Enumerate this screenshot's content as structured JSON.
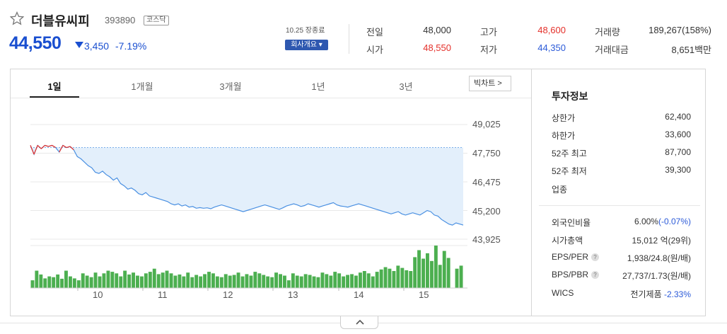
{
  "stock": {
    "name": "더블유씨피",
    "code": "393890",
    "market": "코스닥",
    "price": "44,550",
    "change": "3,450",
    "change_rate": "-7.19%",
    "close_time": "10.25 장종료",
    "company_button": "회사개요 ▾"
  },
  "quotes": {
    "prev_label": "전일",
    "prev": "48,000",
    "high_label": "고가",
    "high": "48,600",
    "volume_label": "거래량",
    "volume": "189,267(158%)",
    "open_label": "시가",
    "open": "48,550",
    "low_label": "저가",
    "low": "44,350",
    "amount_label": "거래대금",
    "amount": "8,651",
    "amount_unit": "백만"
  },
  "tabs": [
    "1일",
    "1개월",
    "3개월",
    "1년",
    "3년"
  ],
  "big_chart_label": "빅차트 >",
  "chart_data": {
    "type": "line",
    "ylim": [
      43925,
      49025
    ],
    "yticks": [
      "49,025",
      "47,750",
      "46,475",
      "45,200",
      "43,925"
    ],
    "xticks": [
      "10",
      "11",
      "12",
      "13",
      "14",
      "15"
    ],
    "prev_close": 48000,
    "price": [
      48100,
      47700,
      48100,
      47950,
      48100,
      48050,
      48100,
      48000,
      47800,
      48100,
      48000,
      48050,
      47900,
      47600,
      47500,
      47350,
      47200,
      47100,
      46900,
      46850,
      46950,
      46800,
      46700,
      46550,
      46650,
      46400,
      46300,
      46150,
      46200,
      46100,
      45950,
      45900,
      46000,
      45850,
      45800,
      45750,
      45700,
      45650,
      45600,
      45500,
      45450,
      45500,
      45400,
      45450,
      45350,
      45380,
      45300,
      45330,
      45300,
      45320,
      45280,
      45350,
      45400,
      45450,
      45400,
      45350,
      45300,
      45250,
      45200,
      45150,
      45200,
      45250,
      45300,
      45350,
      45400,
      45450,
      45400,
      45350,
      45300,
      45250,
      45320,
      45400,
      45450,
      45500,
      45450,
      45380,
      45420,
      45500,
      45450,
      45400,
      45350,
      45400,
      45450,
      45500,
      45550,
      45450,
      45400,
      45380,
      45350,
      45400,
      45450,
      45500,
      45450,
      45400,
      45350,
      45300,
      45250,
      45200,
      45150,
      45100,
      45050,
      45100,
      45150,
      45050,
      45000,
      45050,
      45100,
      45050,
      45000,
      45100,
      45200,
      45150,
      45000,
      44950,
      44800,
      44700,
      44600,
      44550,
      44650,
      44600,
      44550
    ],
    "volume": [
      20,
      45,
      35,
      25,
      30,
      28,
      35,
      24,
      45,
      30,
      25,
      20,
      38,
      32,
      28,
      40,
      30,
      38,
      45,
      42,
      38,
      30,
      45,
      35,
      40,
      32,
      30,
      38,
      42,
      50,
      36,
      40,
      45,
      38,
      32,
      35,
      30,
      40,
      28,
      34,
      30,
      36,
      42,
      38,
      30,
      28,
      36,
      32,
      34,
      40,
      30,
      36,
      32,
      42,
      38,
      34,
      30,
      28,
      40,
      36,
      32,
      20,
      38,
      32,
      30,
      36,
      34,
      30,
      28,
      40,
      36,
      32,
      42,
      38,
      30,
      34,
      36,
      32,
      40,
      44,
      38,
      30,
      42,
      48,
      54,
      50,
      44,
      58,
      52,
      46,
      44,
      80,
      98,
      76,
      90,
      70,
      110,
      60,
      96,
      78,
      0,
      50,
      58
    ]
  },
  "side": {
    "title": "투자정보",
    "upper_label": "상한가",
    "upper": "62,400",
    "lower_label": "하한가",
    "lower": "33,600",
    "w52_high_label": "52주 최고",
    "w52_high": "87,700",
    "w52_low_label": "52주 최저",
    "w52_low": "39,300",
    "sector_label": "업종",
    "foreign_label": "외국인비율",
    "foreign": "6.00%",
    "foreign_chg": "(-0.07%)",
    "mcap_label": "시가총액",
    "mcap": "15,012",
    "mcap_unit": "억(29위)",
    "eps_label": "EPS/PER",
    "eps": "1,938/24.8",
    "eps_unit": "(원/배)",
    "bps_label": "BPS/PBR",
    "bps": "27,737/1.73",
    "bps_unit": "(원/배)",
    "wics_label": "WICS",
    "wics": "전기제품",
    "wics_chg": "-2.33%",
    "help": "?"
  },
  "colors": {
    "down": "#1a4fd0",
    "up": "#e4302a",
    "line": "#4a90e2",
    "bar": "#4caf50"
  }
}
